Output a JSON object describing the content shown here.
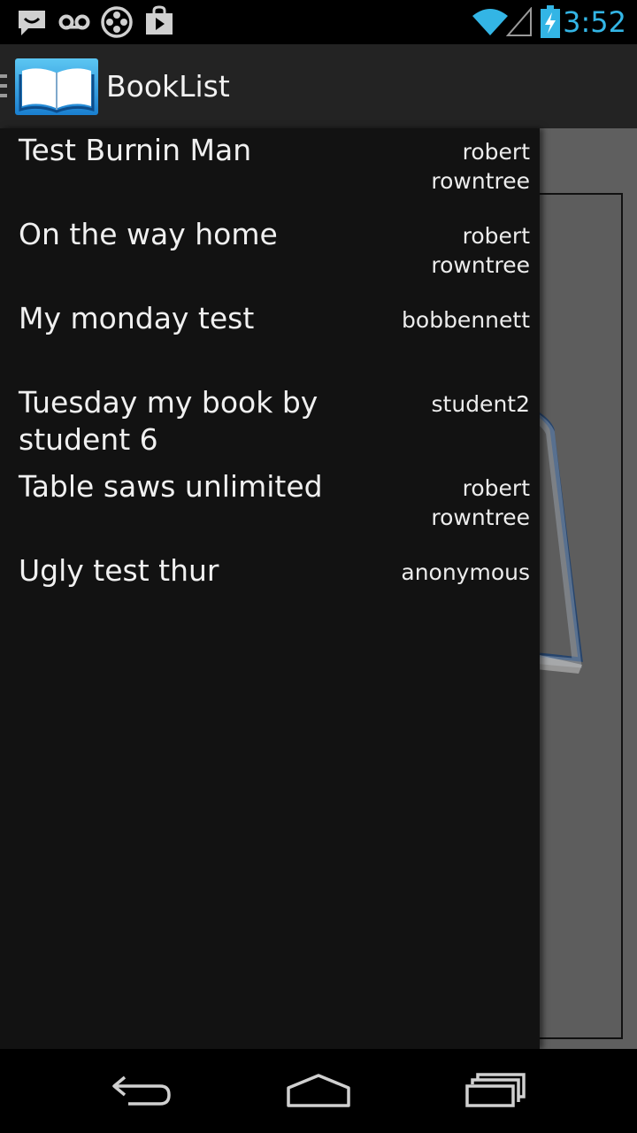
{
  "status_bar": {
    "time": "3:52",
    "left_icons": [
      "message-icon",
      "voicemail-icon",
      "film-reel-icon",
      "play-store-icon"
    ],
    "right_icons": [
      "wifi-icon",
      "signal-icon",
      "battery-charging-icon"
    ],
    "accent_color": "#33b5e5"
  },
  "action_bar": {
    "title": "BookList",
    "app_icon": "book-icon"
  },
  "books": [
    {
      "title": "Test Burnin Man",
      "author": "robert rowntree"
    },
    {
      "title": "On the way home",
      "author": "robert rowntree"
    },
    {
      "title": "My monday test",
      "author": "bobbennett"
    },
    {
      "title": "Tuesday my book by student 6",
      "author": "student2"
    },
    {
      "title": "Table saws unlimited",
      "author": "robert rowntree"
    },
    {
      "title": "Ugly test thur",
      "author": "anonymous"
    }
  ],
  "nav_bar": {
    "buttons": [
      "back-icon",
      "home-icon",
      "recent-apps-icon"
    ]
  }
}
